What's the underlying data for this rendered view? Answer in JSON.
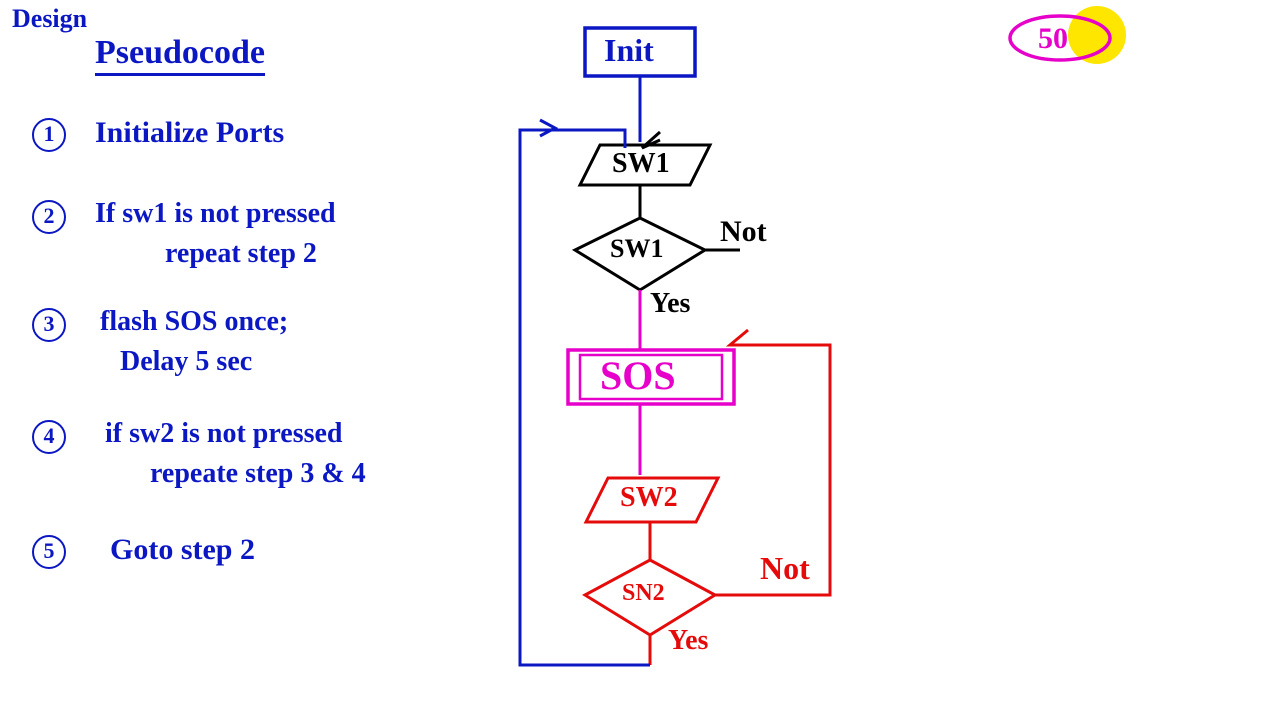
{
  "colors": {
    "blue": "#0b17c2",
    "black": "#000000",
    "magenta": "#e600c9",
    "red": "#e60b0b",
    "yellow": "#ffe600"
  },
  "header": {
    "design": "Design",
    "pseudocode": "Pseudocode"
  },
  "steps": {
    "n1": "1",
    "s1": "Initialize Ports",
    "n2": "2",
    "s2a": "If sw1 is not pressed",
    "s2b": "repeat step 2",
    "n3": "3",
    "s3a": "flash SOS once;",
    "s3b": "Delay 5 sec",
    "n4": "4",
    "s4a": "if sw2 is not pressed",
    "s4b": "repeate step 3 & 4",
    "n5": "5",
    "s5": "Goto step 2"
  },
  "flow": {
    "init": "Init",
    "sw1_read": "SW1",
    "sw1_dec": "SW1",
    "sos": "SOS",
    "sw2_read": "SW2",
    "sw2_dec": "SN2",
    "not1": "Not",
    "yes1": "Yes",
    "not2": "Not",
    "yes2": "Yes"
  },
  "topright": "50"
}
